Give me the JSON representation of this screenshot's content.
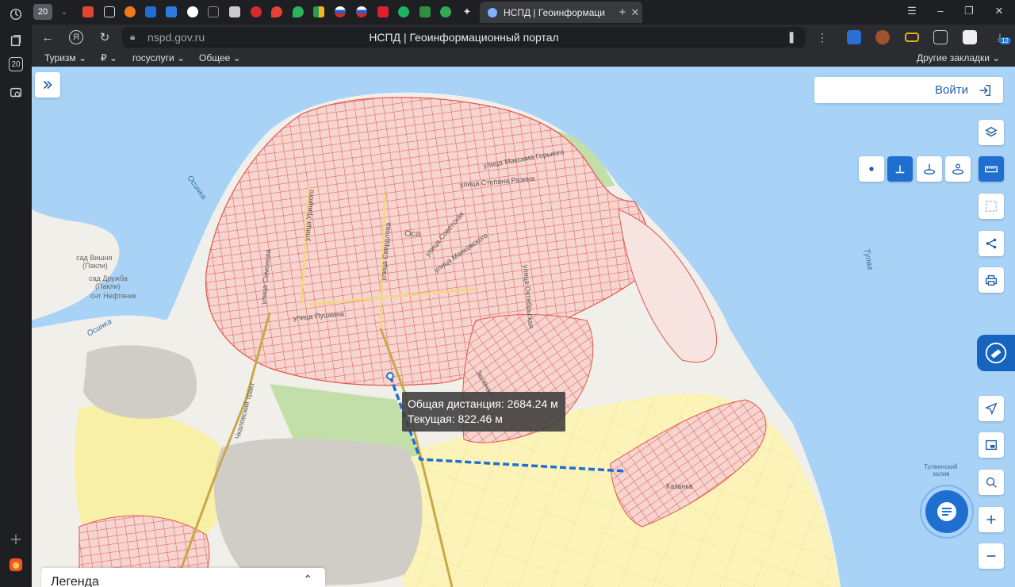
{
  "browser": {
    "tab_count_badge": "20",
    "active_tab_title": "НСПД | Геоинформаци",
    "url": "nspd.gov.ru",
    "page_title": "НСПД | Геоинформационный портал",
    "extension_badge": "12",
    "left_bar_badge": "20",
    "bookmarks": [
      {
        "label": "Туризм"
      },
      {
        "label": "₽"
      },
      {
        "label": "госуслуги"
      },
      {
        "label": "Общее"
      }
    ],
    "other_bookmarks": "Другие закладки"
  },
  "map": {
    "login_label": "Войти",
    "measure": {
      "total_line": "Общая дистанция: 2684.24 м",
      "current_line": "Текущая: 822.46 м"
    },
    "legend_label": "Легенда",
    "labels": {
      "city": "Оса",
      "garden_vishnya": "сад Вишня",
      "garden_vishnya_2": "(Пакли)",
      "garden_druzhba": "сад Дружба",
      "garden_druzhba_2": "(Пакли)",
      "snt_neftyanik": "снт Нефтяник",
      "river_osinka_1": "Осинка",
      "river_osinka_2": "Осинка",
      "river_tulva": "Тулва",
      "bay_1": "Тулвинский",
      "bay_2": "залив",
      "street_gorky": "улица Максима Горького",
      "street_razina": "улица Степана Разина",
      "street_uritskogo": "улица Урицкого",
      "street_sverdlova": "улица Свердлова",
      "street_sovetskaya": "улица Советская",
      "street_mayakovskogo": "улица Маяковского",
      "street_pushkina": "улица Пушкина",
      "street_oktyabrskaya": "улица Октябрьская",
      "street_simonova": "улица Симонова",
      "street_chkalovsky": "Чкаловский тракт",
      "street_zelenaya": "Зелёная",
      "district_kazinka": "Казанка"
    },
    "colors": {
      "water": "#a8d3f7",
      "land": "#f1efe9",
      "parcel_stroke": "#e1574d",
      "parcel_fill": "#f6d4cf",
      "agri_fill": "#fbf3b8",
      "forest": "#c3dfa9",
      "accent": "#1f6fd1"
    }
  }
}
